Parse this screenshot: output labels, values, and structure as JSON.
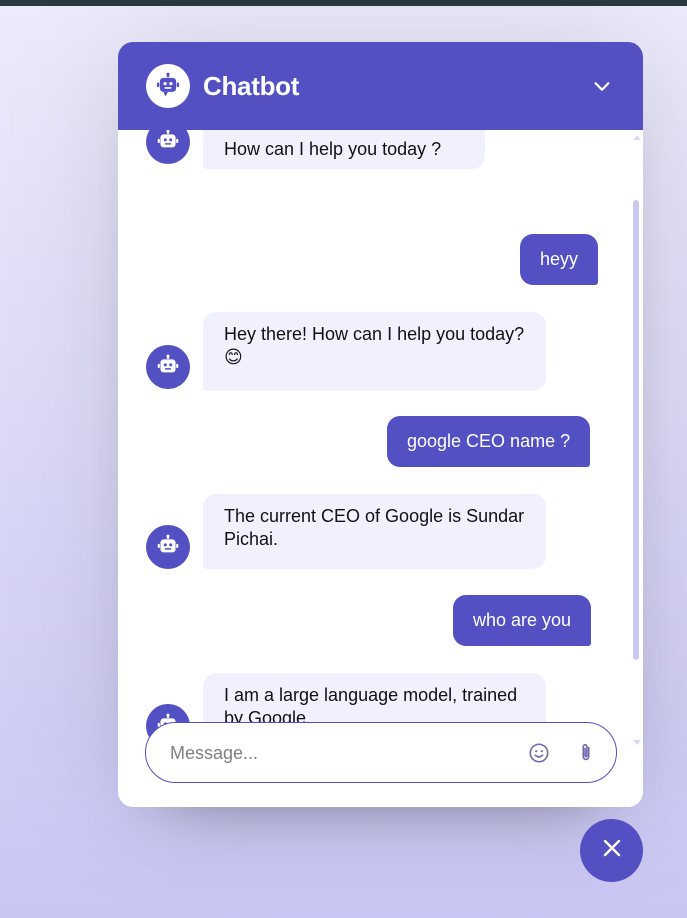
{
  "header": {
    "title": "Chatbot"
  },
  "messages": [
    {
      "role": "bot",
      "text": "How can I help you today ?"
    },
    {
      "role": "user",
      "text": "heyy"
    },
    {
      "role": "bot",
      "text": "Hey there! How can I help you today? 😊"
    },
    {
      "role": "user",
      "text": "google CEO name ?"
    },
    {
      "role": "bot",
      "text": "The current CEO of Google is Sundar Pichai."
    },
    {
      "role": "user",
      "text": "who are you"
    },
    {
      "role": "bot",
      "text": "I am a large language model, trained by Google."
    }
  ],
  "composer": {
    "placeholder": "Message..."
  },
  "icons": {
    "logo": "robot-icon",
    "toggle": "chevron-down-icon",
    "emoji": "smiley-icon",
    "attach": "paperclip-icon",
    "fab": "close-icon"
  },
  "colors": {
    "accent": "#5350c4",
    "bot_bubble": "#f1f0ff",
    "user_text": "#ffffff"
  }
}
